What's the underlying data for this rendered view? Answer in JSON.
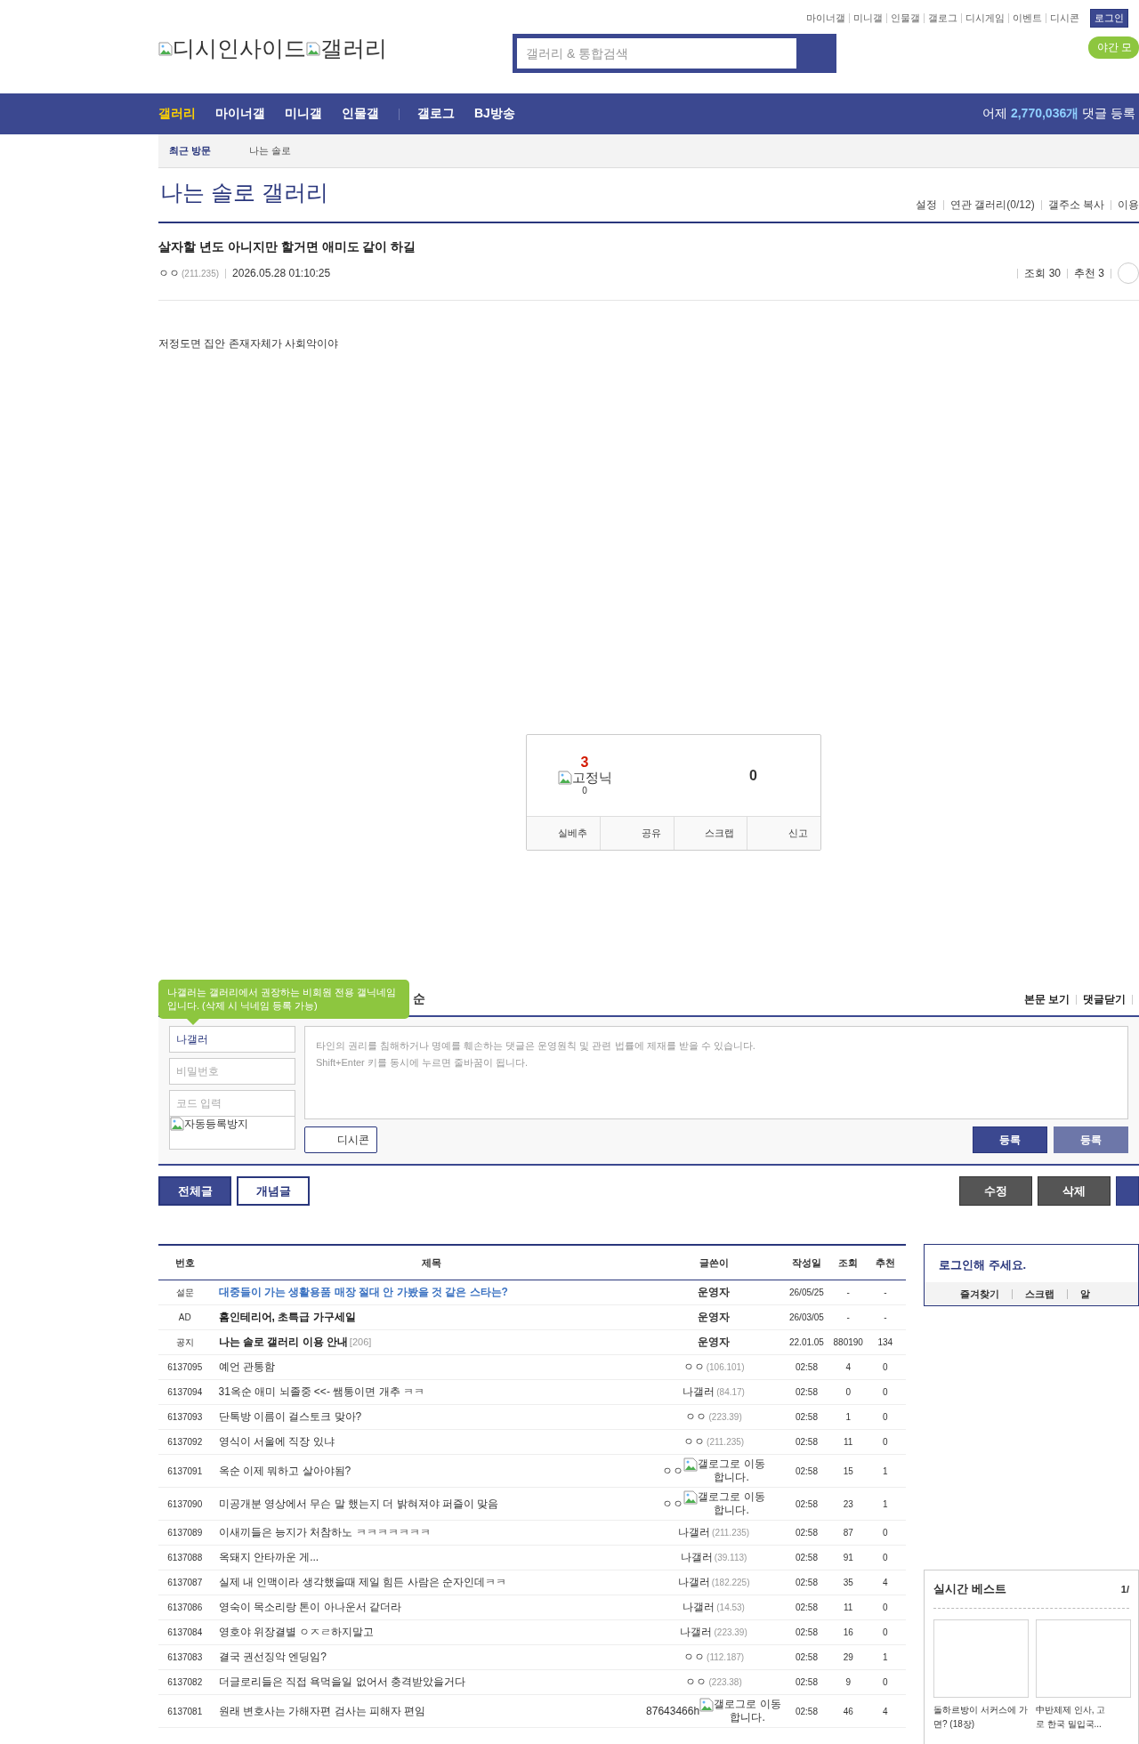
{
  "top_links": [
    "마이너갤",
    "미니갤",
    "인물갤",
    "갤로그",
    "디시게임",
    "이벤트",
    "디시콘"
  ],
  "login_button": "로그인",
  "night_mode": "야간 모",
  "logo": {
    "site": "디시인사이드",
    "section": "갤러리"
  },
  "search": {
    "placeholder": "갤러리 & 통합검색"
  },
  "nav": [
    {
      "label": "갤러리",
      "selected": true
    },
    {
      "label": "마이너갤",
      "selected": false
    },
    {
      "label": "미니갤",
      "selected": false
    },
    {
      "label": "인물갤",
      "selected": false
    },
    {
      "label": "갤로그",
      "selected": false
    },
    {
      "label": "BJ방송",
      "selected": false
    }
  ],
  "nav_stat": "어제 **2,770,036개** 댓글 등록",
  "recent": {
    "label": "최근 방문",
    "items": [
      "나는 솔로"
    ]
  },
  "gallery": {
    "title": "나는 솔로 갤러리",
    "links": [
      "설정",
      "연관 갤러리(0/12)",
      "갤주소 복사",
      "이용"
    ]
  },
  "post": {
    "title": "살자할 년도 아니지만 할거면 애미도 같이 하길",
    "writer": "ㅇㅇ",
    "ip": "(211.235)",
    "date": "2026.05.28 01:10:25",
    "views": "조회 30",
    "recs": "추천 3",
    "body": "저정도면 집안 존재자체가 사회악이야"
  },
  "recommend": {
    "up": "3",
    "fixed_label": "고정닉",
    "fixed_count": "0",
    "down": "0",
    "buttons": [
      "실베추",
      "공유",
      "스크랩",
      "신고"
    ]
  },
  "comments": {
    "tooltip": "나갤러는 갤러리에서 권장하는 비회원 전용 갤닉네임입니다. (삭제 시 닉네임 등록 가능)",
    "header_tail": "순",
    "links": [
      "본문 보기",
      "댓글닫기"
    ],
    "name_value": "나갤러",
    "password_placeholder": "비밀번호",
    "code_placeholder": "코드 입력",
    "captcha_label": "자동등록방지",
    "placeholder_lines": [
      "타인의 권리를 침해하거나 명예를 훼손하는 댓글은 운영원칙 및 관련 법률에 제재를 받을 수 있습니다.",
      "Shift+Enter 키를 동시에 누르면 줄바꿈이 됩니다."
    ],
    "dccon": "디시콘",
    "submit": "등록",
    "submit2": "등록"
  },
  "list_buttons": {
    "left": [
      {
        "label": "전체글",
        "selected": true
      },
      {
        "label": "개념글",
        "selected": false
      }
    ],
    "right": [
      "수정",
      "삭제"
    ]
  },
  "table": {
    "columns": [
      "번호",
      "제목",
      "글쓴이",
      "작성일",
      "조회",
      "추천"
    ],
    "rows": [
      {
        "kind": "survey",
        "num": "설문",
        "title": "대중들이 가는 생활용품 매장 절대 안 가봤을 것 같은 스타는?",
        "writer": "운영자",
        "date": "26/05/25",
        "views": "-",
        "recs": "-"
      },
      {
        "kind": "ad",
        "num": "AD",
        "title": "홈인테리어, 초특급 가구세일",
        "writer": "운영자",
        "date": "26/03/05",
        "views": "-",
        "recs": "-"
      },
      {
        "kind": "notice",
        "num": "공지",
        "title": "나는 솔로 갤러리 이용 안내",
        "count": "[206]",
        "writer": "운영자",
        "date": "22.01.05",
        "views": "880190",
        "recs": "134"
      },
      {
        "kind": "post",
        "num": "6137095",
        "title": "예언 관통함",
        "writer": "ㅇㅇ",
        "ip": "(106.101)",
        "date": "02:58",
        "views": "4",
        "recs": "0"
      },
      {
        "kind": "post",
        "num": "6137094",
        "title": "31옥순 애미 뇌졸중 <<- 쌤통이면 개추 ㅋㅋ",
        "writer": "나갤러",
        "ip": "(84.17)",
        "date": "02:58",
        "views": "0",
        "recs": "0"
      },
      {
        "kind": "post",
        "num": "6137093",
        "title": "단톡방 이름이 걸스토크 맞아?",
        "writer": "ㅇㅇ",
        "ip": "(223.39)",
        "date": "02:58",
        "views": "1",
        "recs": "0"
      },
      {
        "kind": "post",
        "num": "6137092",
        "title": "영식이 서울에 직장 있냐",
        "writer": "ㅇㅇ",
        "ip": "(211.235)",
        "date": "02:58",
        "views": "11",
        "recs": "0"
      },
      {
        "kind": "post",
        "num": "6137091",
        "title": "옥순 이제 뭐하고 살아야됨?",
        "writer": "ㅇㅇ",
        "gallog": "갤로그로 이동합니다.",
        "date": "02:58",
        "views": "15",
        "recs": "1"
      },
      {
        "kind": "post",
        "num": "6137090",
        "title": "미공개분 영상에서 무슨 말 했는지 더 밝혀져야 퍼즐이 맞음",
        "writer": "ㅇㅇ",
        "gallog": "갤로그로 이동합니다.",
        "date": "02:58",
        "views": "23",
        "recs": "1"
      },
      {
        "kind": "post",
        "num": "6137089",
        "title": "이새끼들은 능지가 처참하노 ㅋㅋㅋㅋㅋㅋㅋ",
        "writer": "나갤러",
        "ip": "(211.235)",
        "date": "02:58",
        "views": "87",
        "recs": "0"
      },
      {
        "kind": "post",
        "num": "6137088",
        "title": "옥돼지 안타까운 게...",
        "writer": "나갤러",
        "ip": "(39.113)",
        "date": "02:58",
        "views": "91",
        "recs": "0"
      },
      {
        "kind": "post",
        "num": "6137087",
        "title": "실제 내 인맥이라 생각했을때 제일 힘든 사람은 순자인데ㅋㅋ",
        "writer": "나갤러",
        "ip": "(182.225)",
        "date": "02:58",
        "views": "35",
        "recs": "4"
      },
      {
        "kind": "post",
        "num": "6137086",
        "title": "영숙이 목소리랑 톤이 아나운서 같더라",
        "writer": "나갤러",
        "ip": "(14.53)",
        "date": "02:58",
        "views": "11",
        "recs": "0"
      },
      {
        "kind": "post",
        "num": "6137084",
        "title": "영호야 위장결별 ㅇㅈㄹ하지말고",
        "writer": "나갤러",
        "ip": "(223.39)",
        "date": "02:58",
        "views": "16",
        "recs": "0"
      },
      {
        "kind": "post",
        "num": "6137083",
        "title": "결국 권선징악 엔딩임?",
        "writer": "ㅇㅇ",
        "ip": "(112.187)",
        "date": "02:58",
        "views": "29",
        "recs": "1"
      },
      {
        "kind": "post",
        "num": "6137082",
        "title": "더글로리들은 직접 욕먹을일 없어서 충격받았을거다",
        "writer": "ㅇㅇ",
        "ip": "(223.38)",
        "date": "02:58",
        "views": "9",
        "recs": "0"
      },
      {
        "kind": "post",
        "num": "6137081",
        "title": "원래 변호사는 가해자편 검사는 피해자 편임",
        "writer": "87643466h",
        "gallog": "갤로그로 이동합니다.",
        "date": "02:58",
        "views": "46",
        "recs": "4"
      }
    ]
  },
  "login_box": {
    "title": "로그인해 주세요.",
    "links": [
      "즐겨찾기",
      "스크랩",
      "알"
    ]
  },
  "best": {
    "title": "실시간 베스트",
    "page": "1/",
    "cards": [
      {
        "kind": "picture",
        "lines": [
          "돌하르방이 서커스에 가",
          "면? (18장)"
        ]
      },
      {
        "kind": "picture",
        "lines": [
          "中반체제 인사, 고",
          "로 한국 밀입국..."
        ]
      }
    ]
  }
}
